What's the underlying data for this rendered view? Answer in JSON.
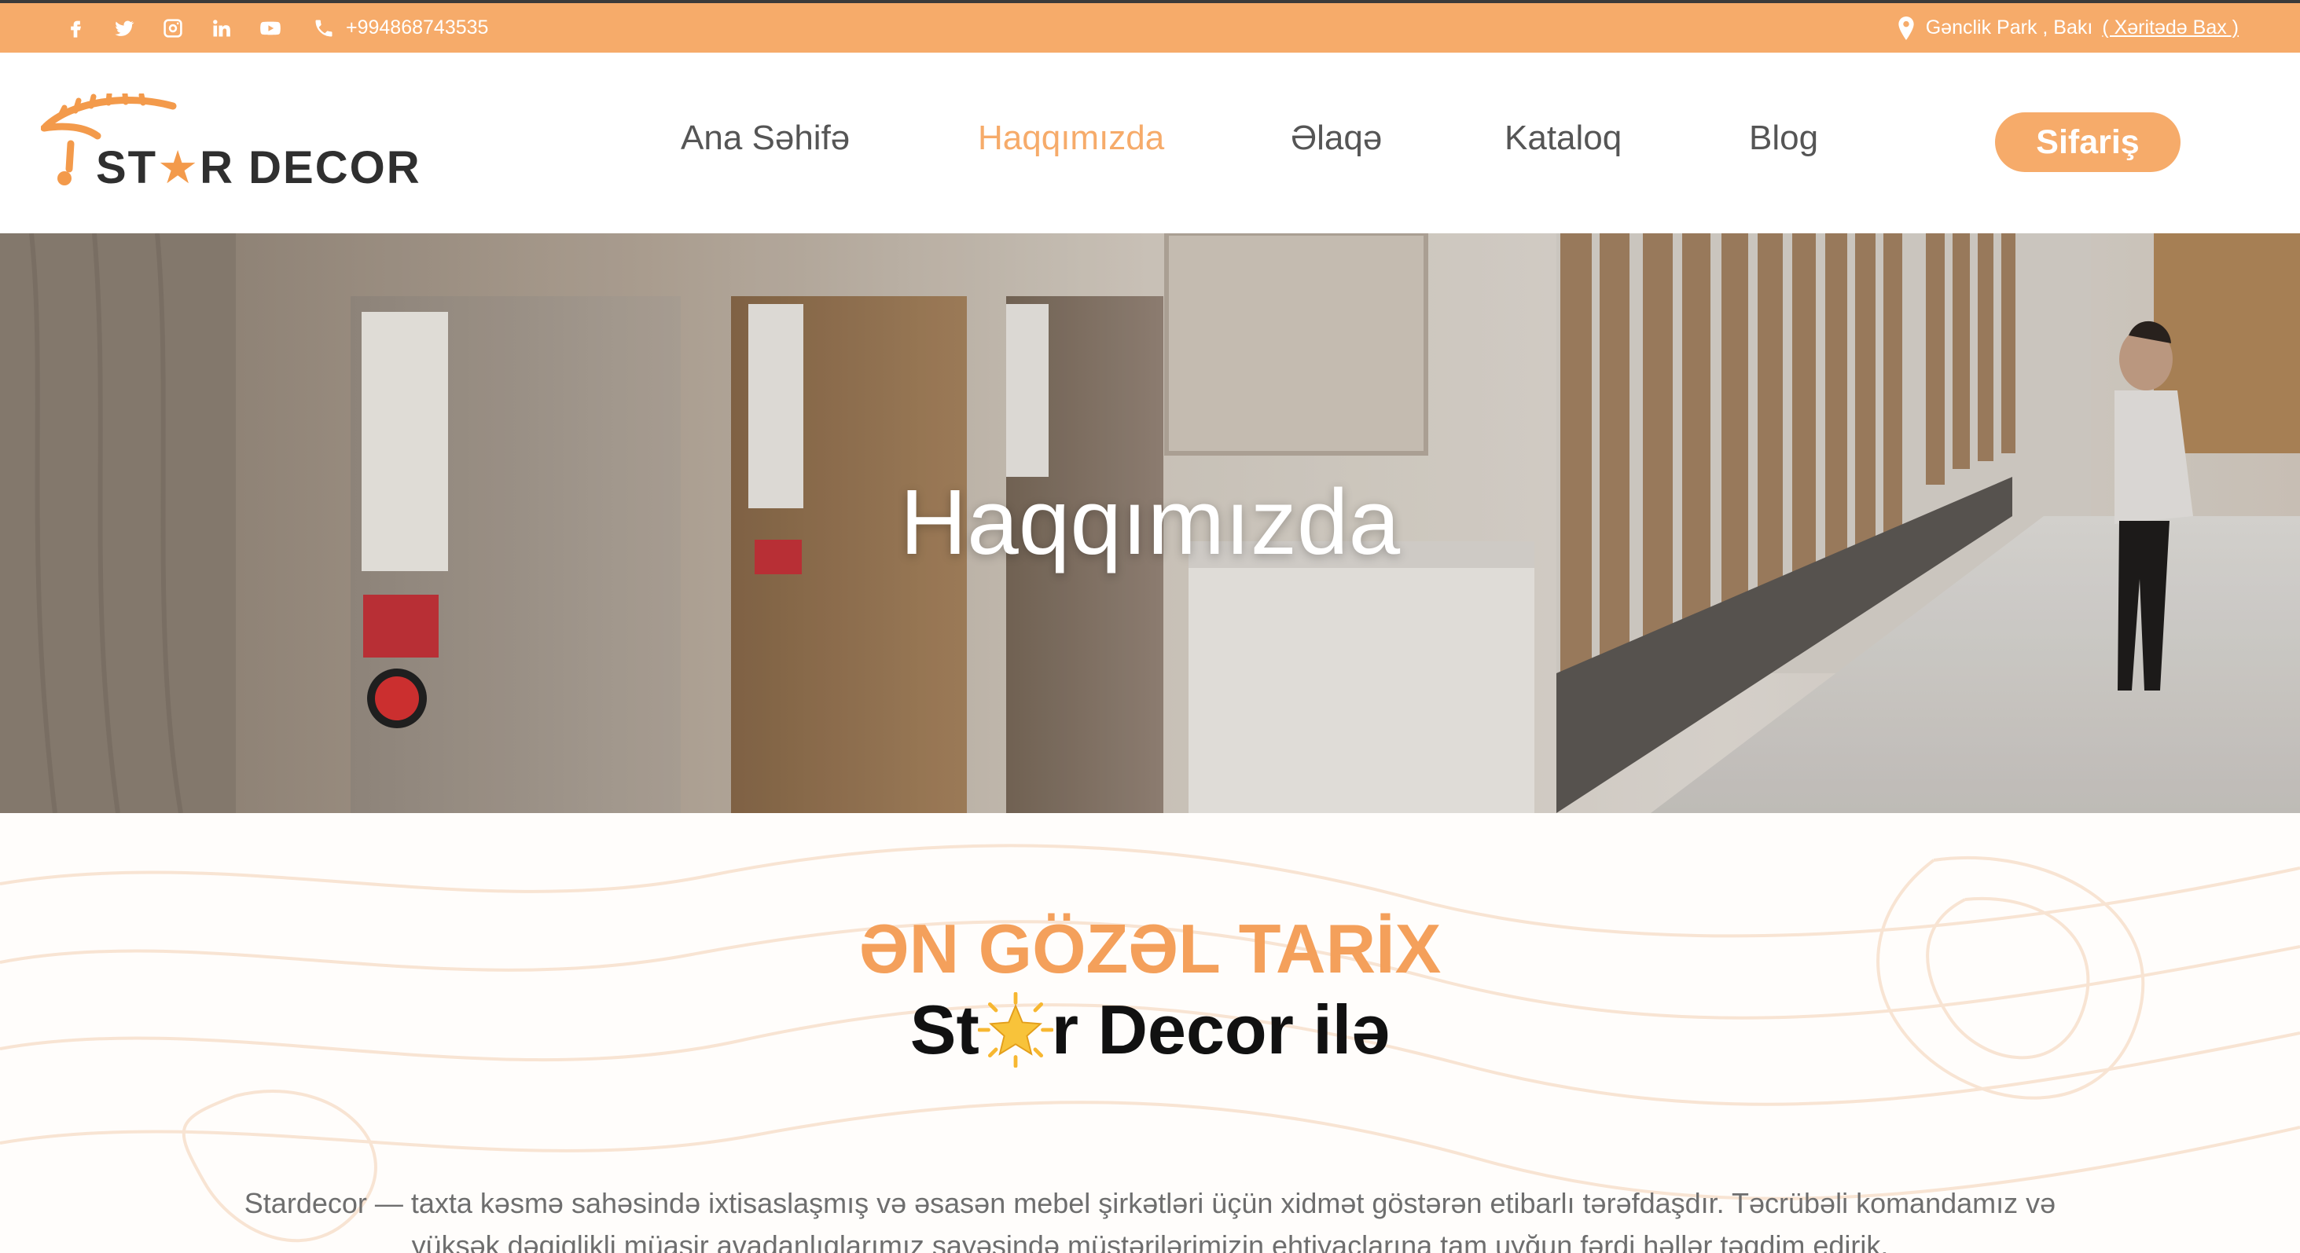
{
  "topbar": {
    "phone": "+994868743535",
    "location": "Gənclik Park , Bakı",
    "map_link": "( Xəritədə Bax )",
    "social_icons": [
      "facebook-icon",
      "twitter-icon",
      "instagram-icon",
      "linkedin-icon",
      "youtube-icon"
    ]
  },
  "header": {
    "logo_prefix": "ST",
    "logo_star": "★",
    "logo_suffix": "R DECOR",
    "nav": [
      {
        "label": "Ana Səhifə",
        "active": false
      },
      {
        "label": "Haqqımızda",
        "active": true
      },
      {
        "label": "Əlaqə",
        "active": false
      },
      {
        "label": "Kataloq",
        "active": false
      },
      {
        "label": "Blog",
        "active": false
      }
    ],
    "order_label": "Sifariş"
  },
  "hero": {
    "title": "Haqqımızda"
  },
  "content": {
    "headline": "ƏN GÖZƏL TARİX",
    "subhead_before": "St",
    "subhead_after": "r Decor ilə",
    "paragraph": "Stardecor — taxta kəsmə sahəsində ixtisaslaşmış və əsasən mebel şirkətləri üçün xidmət göstərən etibarlı tərəfdaşdır. Təcrübəli komandamız və yüksək dəqiqlikli müasir avadanlıqlarımız sayəsində müştərilərimizin ehtiyaclarına tam uyğun fərdi həllər təqdim edirik."
  },
  "colors": {
    "accent": "#f6ab6a",
    "headline": "#f4a05b",
    "text_dark": "#111111",
    "text_muted": "#6e6e6e"
  }
}
